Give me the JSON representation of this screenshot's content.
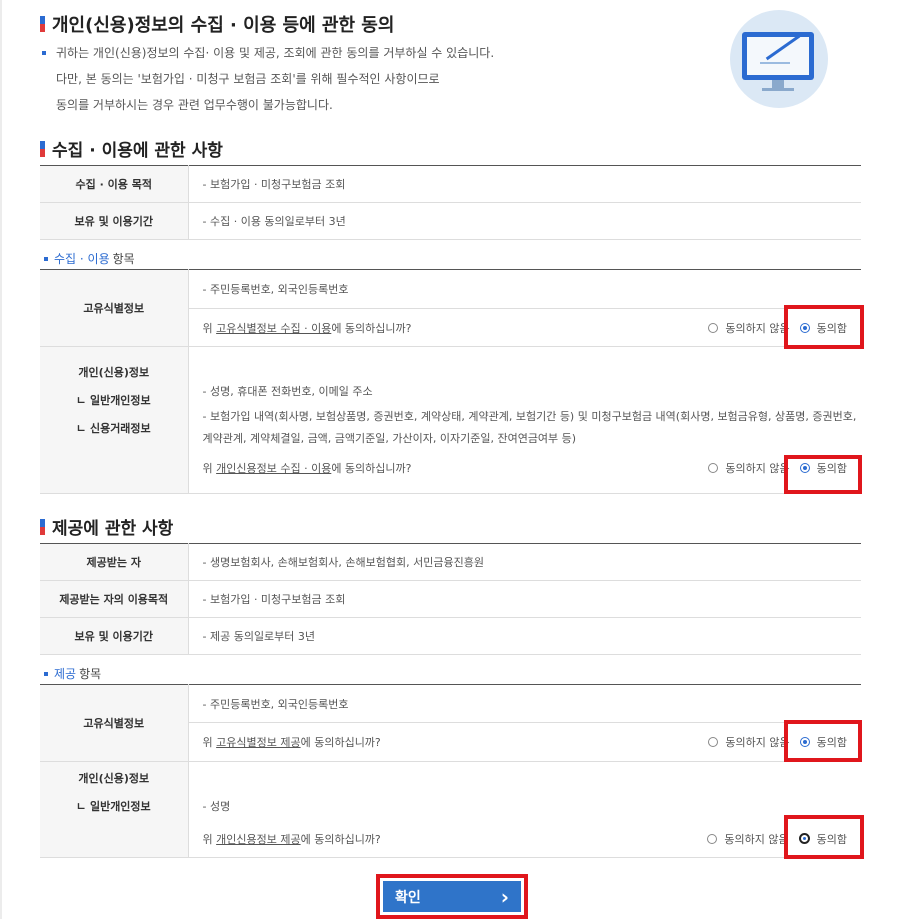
{
  "header": {
    "title": "개인(신용)정보의 수집 · 이용 등에 관한 동의",
    "intro": [
      "귀하는 개인(신용)정보의 수집· 이용 및 제공, 조회에 관한 동의를 거부하실 수 있습니다.",
      "다만, 본 동의는 '보험가입 · 미청구 보험금 조회'를 위해 필수적인 사항이므로",
      "동의를 거부하시는 경우 관련 업무수행이 불가능합니다."
    ]
  },
  "collection": {
    "title": "수집 · 이용에 관한 사항",
    "rows": [
      {
        "label": "수집 · 이용 목적",
        "value": "- 보험가입 · 미청구보험금 조회"
      },
      {
        "label": "보유 및 이용기간",
        "value": "- 수집 · 이용 동의일로부터 3년"
      }
    ],
    "items_label_blue": "수집 · 이용",
    "items_label": "항목",
    "unique": {
      "label": "고유식별정보",
      "value": "- 주민등록번호, 외국인등록번호",
      "question_pre": "위 ",
      "question_link": "고유식별정보 수집 · 이용",
      "question_post": "에 동의하십니까?"
    },
    "personal": {
      "label": "개인(신용)정보",
      "sub1": "ㄴ 일반개인정보",
      "sub2": "ㄴ 신용거래정보",
      "value1": "- 성명, 휴대폰 전화번호, 이메일 주소",
      "value2a": "- 보험가입 내역(회사명, 보험상품명, 증권번호, 계약상태, 계약관계, 보험기간 등) 및 미청구보험금 내역(회사명, 보험금유형, 상품명, 증권번호,",
      "value2b": "계약관계, 계약체결일, 금액, 금액기준일, 가산이자, 이자기준일, 잔여연금여부 등)",
      "question_pre": "위 ",
      "question_link": "개인신용정보 수집 · 이용",
      "question_post": "에 동의하십니까?"
    }
  },
  "provision": {
    "title": "제공에 관한 사항",
    "rows": [
      {
        "label": "제공받는 자",
        "value": "- 생명보험회사, 손해보험회사, 손해보험협회, 서민금융진흥원"
      },
      {
        "label": "제공받는 자의 이용목적",
        "value": "- 보험가입 · 미청구보험금 조회"
      },
      {
        "label": "보유 및 이용기간",
        "value": "- 제공 동의일로부터 3년"
      }
    ],
    "items_label_blue": "제공",
    "items_label": "항목",
    "unique": {
      "label": "고유식별정보",
      "value": "- 주민등록번호, 외국인등록번호",
      "question_pre": "위 ",
      "question_link": "고유식별정보 제공",
      "question_post": "에 동의하십니까?"
    },
    "personal": {
      "label": "개인(신용)정보",
      "sub1": "ㄴ 일반개인정보",
      "value1": "- 성명",
      "question_pre": "위 ",
      "question_link": "개인신용정보 제공",
      "question_post": "에 동의하십니까?"
    }
  },
  "options": {
    "disagree": "동의하지 않음",
    "agree": "동의함"
  },
  "confirm": {
    "label": "확인",
    "arrow": "›"
  }
}
